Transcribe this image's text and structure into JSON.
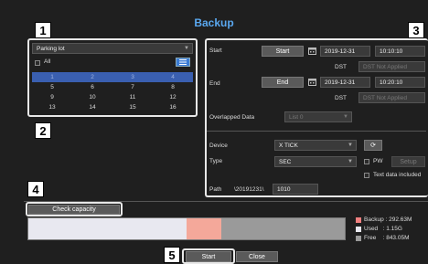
{
  "dialog": {
    "title": "Backup"
  },
  "callouts": {
    "c1": "1",
    "c2": "2",
    "c3": "3",
    "c4": "4",
    "c5": "5"
  },
  "channel": {
    "selected": "Parking lot",
    "all_label": "All",
    "list_icon": "list-icon",
    "grid": [
      [
        "1",
        "2",
        "3",
        "4"
      ],
      [
        "5",
        "6",
        "7",
        "8"
      ],
      [
        "9",
        "10",
        "11",
        "12"
      ],
      [
        "13",
        "14",
        "15",
        "16"
      ]
    ]
  },
  "time": {
    "start_label": "Start",
    "start_button": "Start",
    "start_date": "2019-12-31",
    "start_time": "10:10:10",
    "dst_label": "DST",
    "dst_value": "DST Not Applied",
    "end_label": "End",
    "end_button": "End",
    "end_date": "2019-12-31",
    "end_time": "10:20:10",
    "dst_label2": "DST",
    "dst_value2": "DST Not Applied",
    "overlapped_label": "Overlapped Data",
    "overlapped_value": "List 0"
  },
  "device": {
    "device_label": "Device",
    "device_value": "X TICK",
    "type_label": "Type",
    "type_value": "SEC",
    "pw_label": "PW",
    "setup_button": "Setup",
    "text_data_label": "Text data included",
    "path_label": "Path",
    "path_prefix": "\\20191231\\",
    "path_value": "1010"
  },
  "capacity": {
    "check_button": "Check capacity",
    "used_fraction": 0.5,
    "backup_fraction": 0.11,
    "legend": [
      {
        "label": "Backup : 292.63M",
        "color": "#f08080"
      },
      {
        "label": "Used   : 1.15G",
        "color": "#e8e8f0"
      },
      {
        "label": "Free    : 843.05M",
        "color": "#9a9a9a"
      }
    ]
  },
  "footer": {
    "start_button": "Start",
    "close_button": "Close"
  }
}
